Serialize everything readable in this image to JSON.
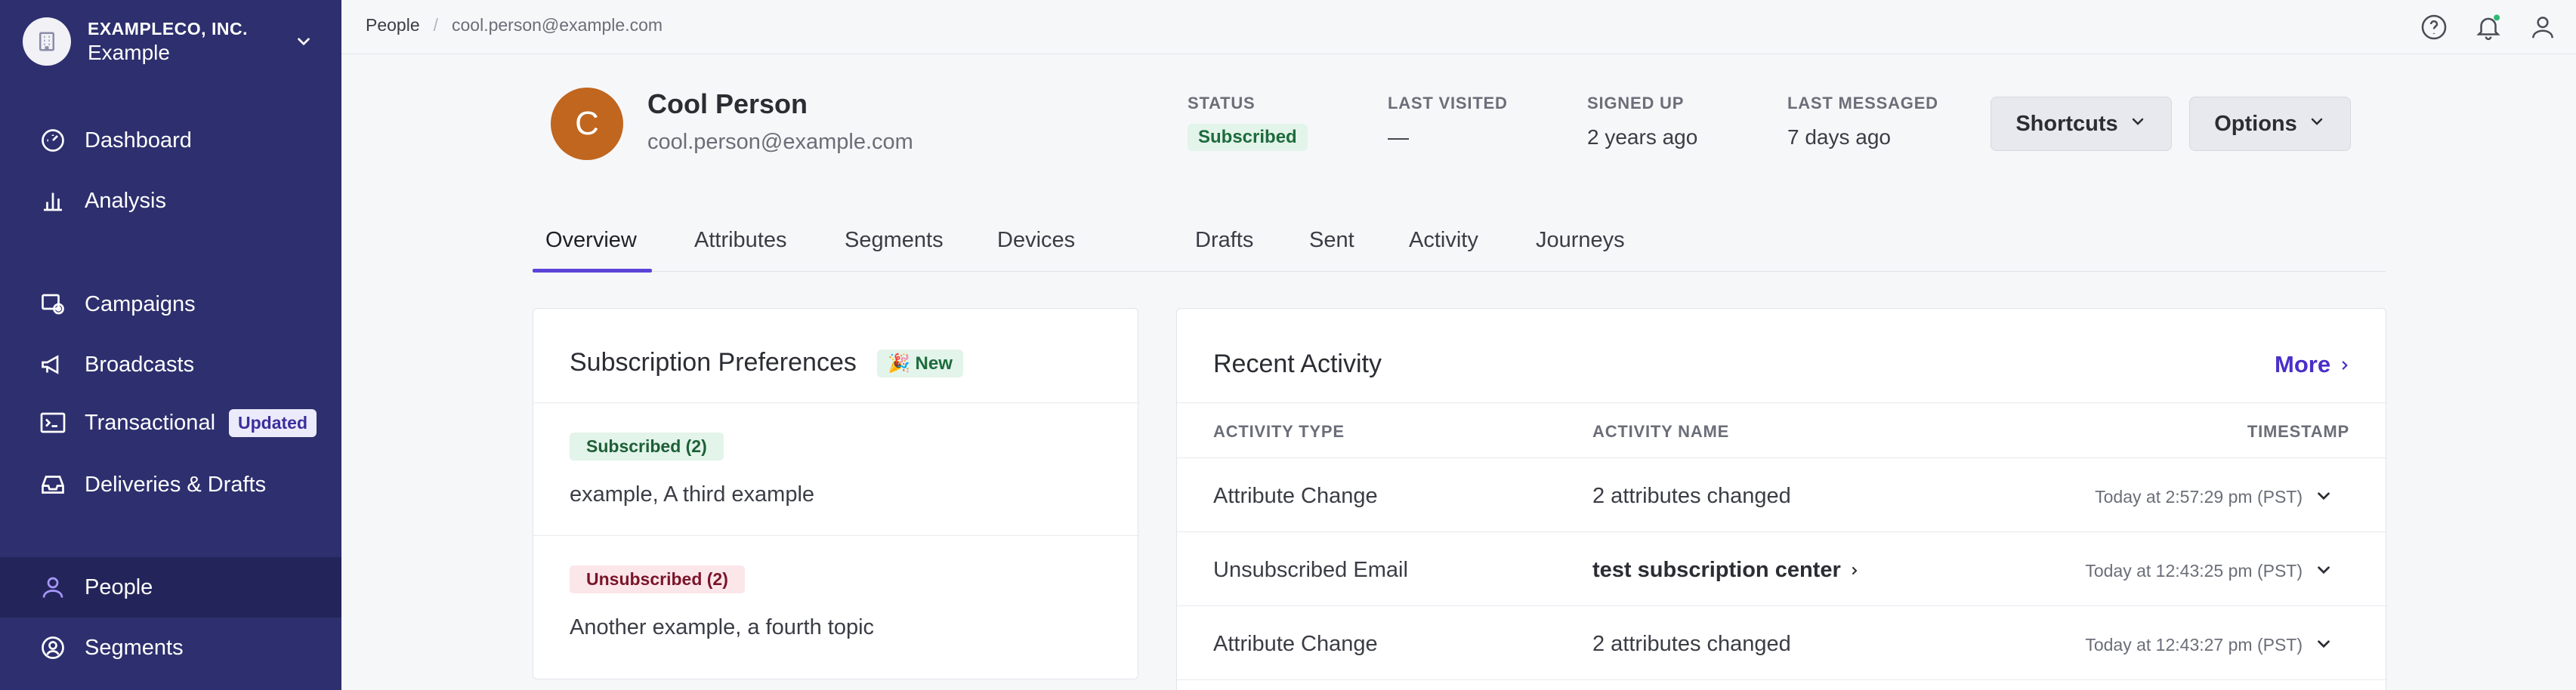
{
  "org": {
    "company": "EXAMPLECO, INC.",
    "name": "Example"
  },
  "sidebar": {
    "items": [
      {
        "label": "Dashboard",
        "icon": "gauge-icon"
      },
      {
        "label": "Analysis",
        "icon": "bar-chart-icon"
      },
      {
        "label": "Campaigns",
        "icon": "campaign-icon"
      },
      {
        "label": "Broadcasts",
        "icon": "megaphone-icon"
      },
      {
        "label": "Transactional",
        "icon": "terminal-icon",
        "badge": "Updated"
      },
      {
        "label": "Deliveries & Drafts",
        "icon": "inbox-icon"
      },
      {
        "label": "People",
        "icon": "person-icon",
        "active": true
      },
      {
        "label": "Segments",
        "icon": "segment-icon"
      }
    ]
  },
  "breadcrumb": {
    "root": "People",
    "separator": "/",
    "current": "cool.person@example.com"
  },
  "profile": {
    "initial": "C",
    "name": "Cool Person",
    "email": "cool.person@example.com",
    "stats": {
      "status_label": "STATUS",
      "status_value": "Subscribed",
      "visited_label": "LAST VISITED",
      "visited_value": "—",
      "signed_label": "SIGNED UP",
      "signed_value": "2 years ago",
      "messaged_label": "LAST MESSAGED",
      "messaged_value": "7 days ago"
    },
    "buttons": {
      "shortcuts": "Shortcuts",
      "options": "Options"
    }
  },
  "tabs": [
    "Overview",
    "Attributes",
    "Segments",
    "Devices",
    "Drafts",
    "Sent",
    "Activity",
    "Journeys"
  ],
  "subscription": {
    "title": "Subscription Preferences",
    "new_badge": "🎉 New",
    "subscribed_label": "Subscribed (2)",
    "subscribed_topics": "example, A third example",
    "unsubscribed_label": "Unsubscribed (2)",
    "unsubscribed_topics": "Another example, a fourth topic"
  },
  "activity": {
    "title": "Recent Activity",
    "more": "More",
    "columns": {
      "type": "ACTIVITY TYPE",
      "name": "ACTIVITY NAME",
      "timestamp": "TIMESTAMP"
    },
    "rows": [
      {
        "type": "Attribute Change",
        "name": "2 attributes changed",
        "timestamp": "Today at 2:57:29 pm (PST)"
      },
      {
        "type": "Unsubscribed Email",
        "name": "test subscription center",
        "timestamp": "Today at 12:43:25 pm (PST)"
      },
      {
        "type": "Attribute Change",
        "name": "2 attributes changed",
        "timestamp": "Today at 12:43:27 pm (PST)"
      }
    ]
  },
  "colors": {
    "sidebar": "#2d2f6e",
    "accent": "#5b43d8",
    "avatar": "#c0661f",
    "link": "#4a2fc8"
  }
}
